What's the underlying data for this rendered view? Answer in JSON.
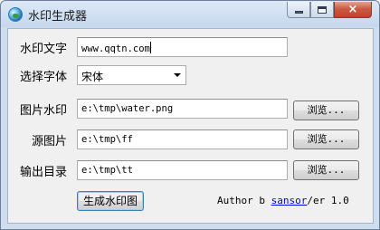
{
  "window": {
    "title": "水印生成器",
    "icon": "globe-icon",
    "controls": {
      "minimize": "minimize-icon",
      "maximize": "maximize-icon",
      "close": "×"
    }
  },
  "form": {
    "watermark_text": {
      "label": "水印文字",
      "value": "www.qqtn.com"
    },
    "font": {
      "label": "选择字体",
      "value": "宋体"
    },
    "image_watermark": {
      "label": "图片水印",
      "value": "e:\\tmp\\water.png",
      "browse": "浏览..."
    },
    "source_image": {
      "label": "源图片",
      "value": "e:\\tmp\\ff",
      "browse": "浏览..."
    },
    "output_dir": {
      "label": "输出目录",
      "value": "e:\\tmp\\tt",
      "browse": "浏览..."
    }
  },
  "generate_button": "生成水印图",
  "footer": {
    "prefix": "Author b",
    "link": "sansor",
    "suffix": "/er 1.0"
  }
}
